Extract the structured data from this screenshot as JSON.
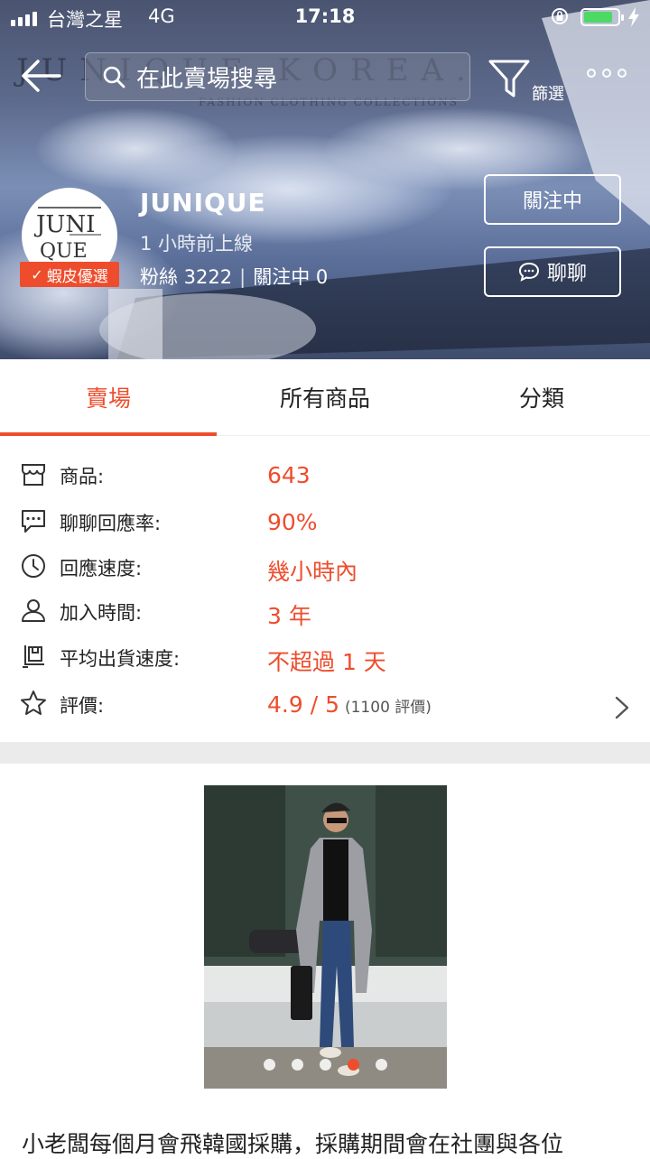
{
  "status_bar": {
    "carrier": "台灣之星",
    "network": "4G",
    "time": "17:18",
    "battery_level": 0.85
  },
  "nav": {
    "search_placeholder": "在此賣場搜尋",
    "filter_label": "篩選"
  },
  "banner": {
    "watermark": "JUNIQUE KOREA.",
    "watermark_sub": "FASHION CLOTHING COLLECTIONS"
  },
  "shop": {
    "logo_top": "JUNI",
    "logo_bottom": "QUE",
    "badge": "蝦皮優選",
    "name": "JUNIQUE",
    "last_online": "1 小時前上線",
    "followers": "粉絲 3222",
    "following": "關注中 0",
    "follow_button": "關注中",
    "chat_button": "聊聊"
  },
  "tabs": [
    {
      "label": "賣場",
      "active": true
    },
    {
      "label": "所有商品",
      "active": false
    },
    {
      "label": "分類",
      "active": false
    }
  ],
  "info": [
    {
      "icon": "store-icon",
      "label": "商品:",
      "value": "643"
    },
    {
      "icon": "chat-bubble-icon",
      "label": "聊聊回應率:",
      "value": "90%"
    },
    {
      "icon": "clock-icon",
      "label": "回應速度:",
      "value": "幾小時內"
    },
    {
      "icon": "user-icon",
      "label": "加入時間:",
      "value": "3 年"
    },
    {
      "icon": "shipping-box-icon",
      "label": "平均出貨速度:",
      "value": "不超過 1 天"
    },
    {
      "icon": "star-icon",
      "label": "評價:",
      "value": "4.9 / 5",
      "extra": "(1100 評價)"
    }
  ],
  "carousel": {
    "count": 5,
    "active_index": 3
  },
  "description": "小老闆每個月會飛韓國採購，採購期間會在社團與各位"
}
